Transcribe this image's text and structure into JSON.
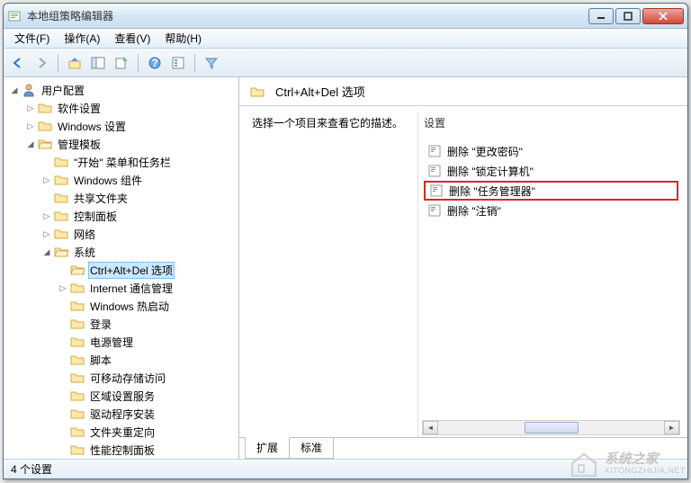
{
  "window": {
    "title": "本地组策略编辑器"
  },
  "menu": {
    "file": "文件(F)",
    "action": "操作(A)",
    "view": "查看(V)",
    "help": "帮助(H)"
  },
  "tree": {
    "root": "用户配置",
    "node1": "软件设置",
    "node2": "Windows 设置",
    "node3": "管理模板",
    "n3_1": "\"开始\" 菜单和任务栏",
    "n3_2": "Windows 组件",
    "n3_3": "共享文件夹",
    "n3_4": "控制面板",
    "n3_5": "网络",
    "n3_6": "系统",
    "n3_6_1": "Ctrl+Alt+Del 选项",
    "n3_6_2": "Internet 通信管理",
    "n3_6_3": "Windows 热启动",
    "n3_6_4": "登录",
    "n3_6_5": "电源管理",
    "n3_6_6": "脚本",
    "n3_6_7": "可移动存储访问",
    "n3_6_8": "区域设置服务",
    "n3_6_9": "驱动程序安装",
    "n3_6_10": "文件夹重定向",
    "n3_6_11": "性能控制面板"
  },
  "path": {
    "current": "Ctrl+Alt+Del 选项"
  },
  "detail": {
    "prompt": "选择一个项目来查看它的描述。",
    "settings_label": "设置",
    "items": [
      "删除 \"更改密码\"",
      "删除 \"锁定计算机\"",
      "删除 \"任务管理器\"",
      "删除 \"注销\""
    ]
  },
  "tabs": {
    "extended": "扩展",
    "standard": "标准"
  },
  "status": {
    "text": "4 个设置"
  },
  "watermark": {
    "text": "系统之家",
    "url": "XITONGZHIJIA.NET"
  }
}
